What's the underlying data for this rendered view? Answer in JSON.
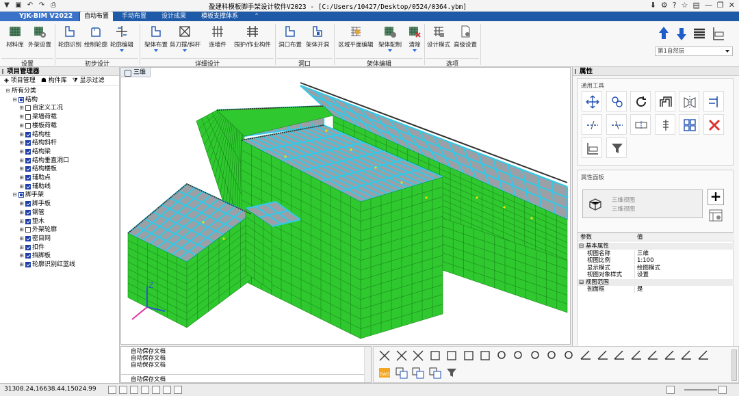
{
  "title": "盈建科模板脚手架设计软件V2023 - [C:/Users/10427/Desktop/0524/0364.ybm]",
  "brand": "YJK-BIM V2022",
  "tabs": [
    {
      "label": "自动布置",
      "active": true
    },
    {
      "label": "手动布置"
    },
    {
      "label": "设计成果"
    },
    {
      "label": "模板支撑体系",
      "highlight": true
    }
  ],
  "ribbon": {
    "buttons": [
      {
        "label": "材料库"
      },
      {
        "label": "外架设置"
      },
      {
        "label": "轮廓识别"
      },
      {
        "label": "绘制轮廓"
      },
      {
        "label": "轮廓编辑"
      },
      {
        "label": "架体布置"
      },
      {
        "label": "剪刀撑/斜杆"
      },
      {
        "label": "连墙件"
      },
      {
        "label": "围护/作业构件"
      },
      {
        "label": "洞口布置"
      },
      {
        "label": "架体开洞"
      },
      {
        "label": "区域平面编辑"
      },
      {
        "label": "架体配制"
      },
      {
        "label": "清除"
      },
      {
        "label": "设计模式"
      },
      {
        "label": "高级设置"
      }
    ],
    "groups": [
      "设置",
      "初步设计",
      "详细设计",
      "洞口",
      "架体编辑",
      "选项"
    ],
    "floor": "第1自然层"
  },
  "left": {
    "title": "项目管理器",
    "subtabs": [
      "项目管理",
      "构件库",
      "显示过滤"
    ],
    "tree": [
      {
        "label": "所有分类",
        "level": 0,
        "exp": "-",
        "chk": "none"
      },
      {
        "label": "结构",
        "level": 1,
        "exp": "-",
        "chk": "partial"
      },
      {
        "label": "自定义工况",
        "level": 2,
        "exp": "+",
        "chk": "off"
      },
      {
        "label": "梁墙荷载",
        "level": 2,
        "exp": "+",
        "chk": "off"
      },
      {
        "label": "楼板荷载",
        "level": 2,
        "exp": "+",
        "chk": "off"
      },
      {
        "label": "结构柱",
        "level": 2,
        "exp": "+",
        "chk": "on"
      },
      {
        "label": "结构斜杆",
        "level": 2,
        "exp": "+",
        "chk": "on"
      },
      {
        "label": "结构梁",
        "level": 2,
        "exp": "+",
        "chk": "on"
      },
      {
        "label": "结构垂直洞口",
        "level": 2,
        "exp": "+",
        "chk": "on"
      },
      {
        "label": "结构楼板",
        "level": 2,
        "exp": "+",
        "chk": "on"
      },
      {
        "label": "辅助点",
        "level": 2,
        "exp": "+",
        "chk": "on"
      },
      {
        "label": "辅助线",
        "level": 2,
        "exp": "+",
        "chk": "on"
      },
      {
        "label": "脚手架",
        "level": 1,
        "exp": "-",
        "chk": "partial"
      },
      {
        "label": "脚手板",
        "level": 2,
        "exp": "+",
        "chk": "on"
      },
      {
        "label": "钢管",
        "level": 2,
        "exp": "+",
        "chk": "on"
      },
      {
        "label": "垫木",
        "level": 2,
        "exp": "+",
        "chk": "on"
      },
      {
        "label": "外架轮廓",
        "level": 2,
        "exp": "+",
        "chk": "off"
      },
      {
        "label": "密目网",
        "level": 2,
        "exp": "+",
        "chk": "on"
      },
      {
        "label": "扣件",
        "level": 2,
        "exp": "+",
        "chk": "on"
      },
      {
        "label": "挡脚板",
        "level": 2,
        "exp": "+",
        "chk": "on"
      },
      {
        "label": "轮廓识别红蓝线",
        "level": 2,
        "exp": "+",
        "chk": "on"
      }
    ]
  },
  "viewport": {
    "tab": "三维"
  },
  "right": {
    "title": "属性",
    "tools_caption": "通用工具",
    "attr_caption": "属性面板",
    "view_card": [
      "三维视图",
      "三维视图"
    ],
    "table_header": [
      "参数",
      "值"
    ],
    "groups": [
      {
        "label": "基本属性",
        "rows": [
          {
            "k": "视图名称",
            "v": "三维"
          },
          {
            "k": "视图比例",
            "v": "1:100"
          },
          {
            "k": "显示模式",
            "v": "绘图模式"
          },
          {
            "k": "视图对象样式",
            "v": "设置"
          }
        ]
      },
      {
        "label": "视图范围",
        "rows": [
          {
            "k": "剖面框",
            "v": "是"
          }
        ]
      }
    ]
  },
  "log": {
    "lines": [
      "自动保存文档",
      "自动保存文档",
      "自动保存文档"
    ],
    "input": "自动保存文档"
  },
  "status": {
    "coords": "31308.24,16638.44,15024.99"
  },
  "colors": {
    "accent": "#1e5aa8",
    "mesh": "#2fc82f",
    "beam": "#36c8e6"
  }
}
